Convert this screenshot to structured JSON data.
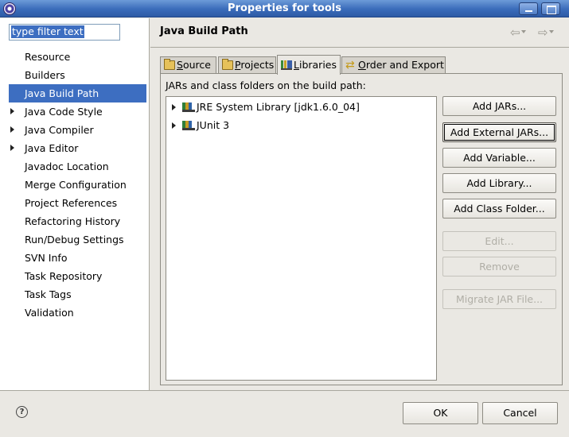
{
  "window": {
    "title": "Properties for tools"
  },
  "filter": {
    "value": "type filter text"
  },
  "sidebar": {
    "items": [
      {
        "label": "Resource",
        "expandable": false
      },
      {
        "label": "Builders",
        "expandable": false
      },
      {
        "label": "Java Build Path",
        "expandable": false,
        "selected": true
      },
      {
        "label": "Java Code Style",
        "expandable": true
      },
      {
        "label": "Java Compiler",
        "expandable": true
      },
      {
        "label": "Java Editor",
        "expandable": true
      },
      {
        "label": "Javadoc Location",
        "expandable": false
      },
      {
        "label": "Merge Configuration",
        "expandable": false
      },
      {
        "label": "Project References",
        "expandable": false
      },
      {
        "label": "Refactoring History",
        "expandable": false
      },
      {
        "label": "Run/Debug Settings",
        "expandable": false
      },
      {
        "label": "SVN Info",
        "expandable": false
      },
      {
        "label": "Task Repository",
        "expandable": false
      },
      {
        "label": "Task Tags",
        "expandable": false
      },
      {
        "label": "Validation",
        "expandable": false
      }
    ]
  },
  "page": {
    "title": "Java Build Path"
  },
  "tabs": [
    {
      "label": "Source",
      "mnemonic": "S",
      "rest": "ource",
      "icon": "source-folder-icon"
    },
    {
      "label": "Projects",
      "mnemonic": "P",
      "rest": "rojects",
      "icon": "projects-icon"
    },
    {
      "label": "Libraries",
      "mnemonic": "L",
      "rest": "ibraries",
      "icon": "libraries-icon",
      "active": true
    },
    {
      "label": "Order and Export",
      "mnemonic": "O",
      "rest": "rder and Export",
      "icon": "order-export-icon"
    }
  ],
  "libraries": {
    "label": "JARs and class folders on the build path:",
    "entries": [
      {
        "label": "JRE System Library [jdk1.6.0_04]"
      },
      {
        "label": "JUnit 3"
      }
    ]
  },
  "buttons": {
    "add_jars": "Add JARs...",
    "add_external_jars": "Add External JARs...",
    "add_variable": "Add Variable...",
    "add_library": "Add Library...",
    "add_class_folder": "Add Class Folder...",
    "edit": "Edit...",
    "remove": "Remove",
    "migrate_jar": "Migrate JAR File..."
  },
  "footer": {
    "ok": "OK",
    "cancel": "Cancel"
  },
  "colors": {
    "selection": "#3d6ec1",
    "titlebar": "#3a6cba"
  }
}
